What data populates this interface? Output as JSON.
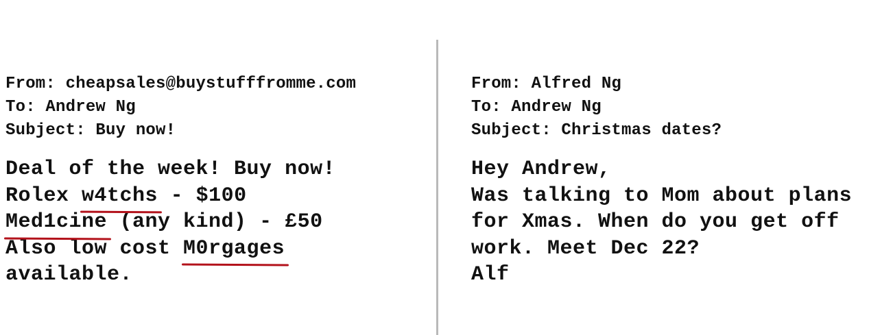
{
  "spam_email": {
    "from": "From: cheapsales@buystufffromme.com",
    "to": "To: Andrew Ng",
    "subject": "Subject: Buy now!",
    "body": {
      "line1": "Deal of the week! Buy now!",
      "line2_prefix": "Rolex ",
      "line2_marked": "w4tchs",
      "line2_suffix": " - $100",
      "line3_marked": "Med1cine",
      "line3_suffix": " (any kind) - £50",
      "line4_prefix": "Also low cost ",
      "line4_marked": "M0rgages",
      "line5": "available."
    },
    "underline_color": "#b3121b"
  },
  "normal_email": {
    "from": "From: Alfred Ng",
    "to": "To: Andrew Ng",
    "subject": "Subject: Christmas dates?",
    "body": {
      "line1": "Hey Andrew,",
      "line2": "Was talking to Mom about plans",
      "line3": "for Xmas. When do you get off",
      "line4": "work. Meet Dec 22?",
      "line5": "Alf"
    }
  }
}
